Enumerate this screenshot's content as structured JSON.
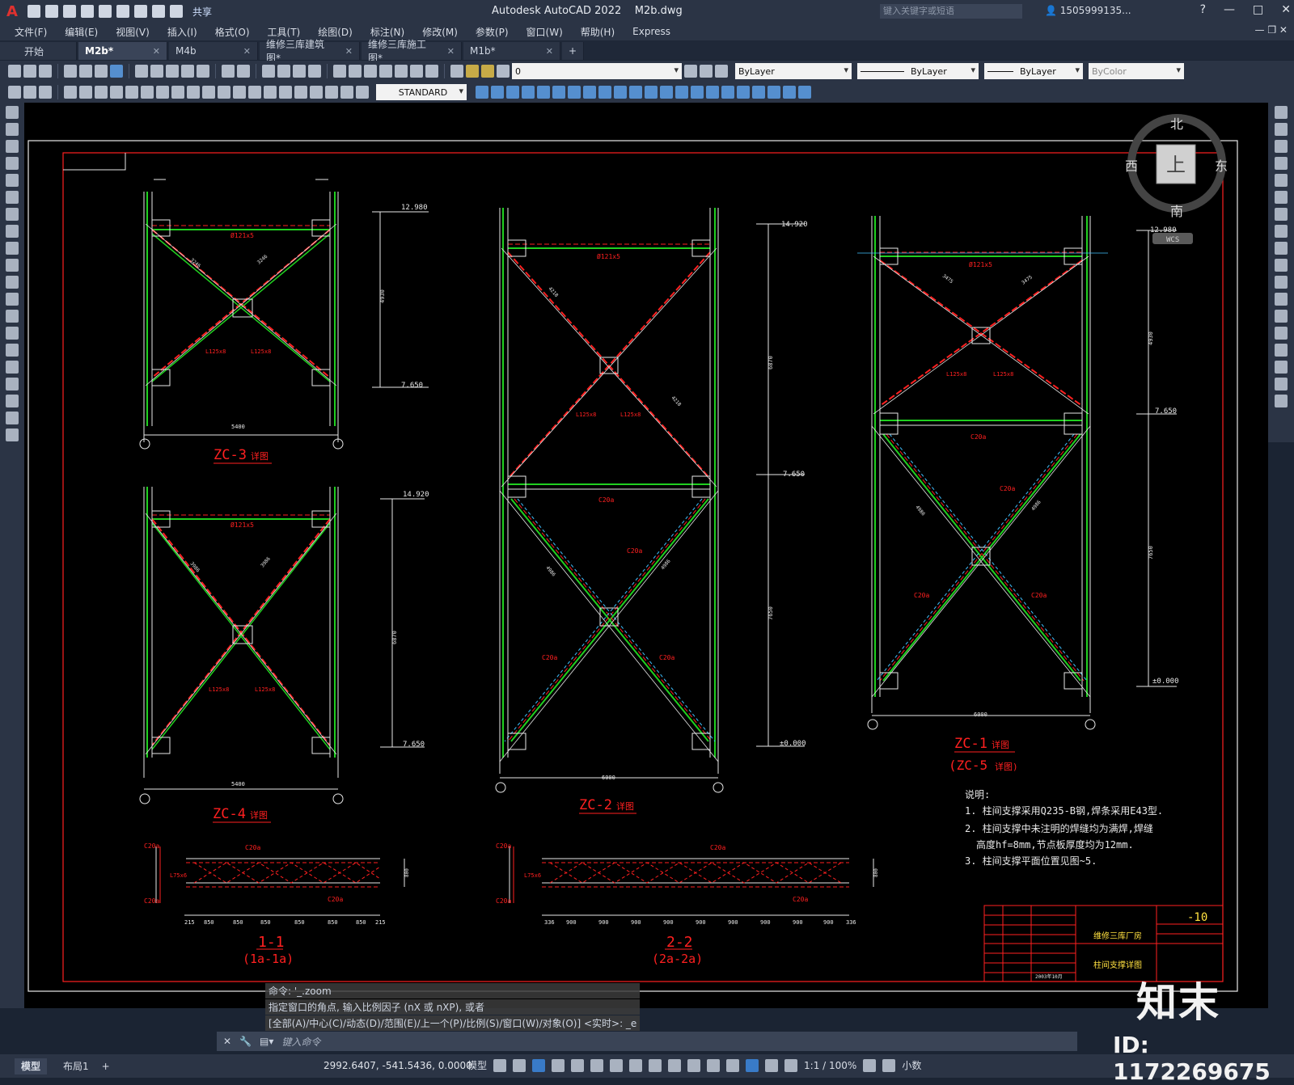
{
  "app": {
    "title": "Autodesk AutoCAD 2022",
    "file": "M2b.dwg",
    "search_placeholder": "键入关键字或短语",
    "user": "1505999135...",
    "share": "共享"
  },
  "menu": [
    "文件(F)",
    "编辑(E)",
    "视图(V)",
    "插入(I)",
    "格式(O)",
    "工具(T)",
    "绘图(D)",
    "标注(N)",
    "修改(M)",
    "参数(P)",
    "窗口(W)",
    "帮助(H)",
    "Express"
  ],
  "tabs": [
    {
      "label": "开始",
      "active": false,
      "closable": false
    },
    {
      "label": "M2b*",
      "active": true,
      "closable": true
    },
    {
      "label": "M4b",
      "active": false,
      "closable": true
    },
    {
      "label": "维修三库建筑图*",
      "active": false,
      "closable": true
    },
    {
      "label": "维修三库施工图*",
      "active": false,
      "closable": true
    },
    {
      "label": "M1b*",
      "active": false,
      "closable": true
    }
  ],
  "toolbar": {
    "layer": "0",
    "color": "ByLayer",
    "linetype": "ByLayer",
    "lineweight": "ByLayer",
    "plotstyle": "ByColor",
    "textstyle": "STANDARD"
  },
  "viewcube": {
    "north": "北",
    "south": "南",
    "east": "东",
    "west": "西",
    "top": "上",
    "wcs": "WCS"
  },
  "drawing": {
    "zc3": {
      "title": "ZC-3",
      "suffix": "详图",
      "width_dim": "5400",
      "top_elev": "12.980",
      "bot_elev": "7.650",
      "height_dim": "4930",
      "rod": "Ø121x5",
      "brace_a": "L125x8",
      "brace_b": "L125x8",
      "diag1": "3246",
      "diag2": "3246"
    },
    "zc4": {
      "title": "ZC-4",
      "suffix": "详图",
      "width_dim": "5400",
      "top_elev": "14.920",
      "bot_elev": "7.650",
      "height_dim": "6870",
      "rod": "Ø121x5",
      "brace_a": "L125x8",
      "brace_b": "L125x8",
      "diag1": "3986",
      "diag2": "3986"
    },
    "zc2": {
      "title": "ZC-2",
      "suffix": "详图",
      "width_dim": "6000",
      "top_elev": "14.920",
      "mid_elev": "7.650",
      "bot_elev": "±0.000",
      "h_upper": "6870",
      "h_lower": "7650",
      "rod": "Ø121x5",
      "brace_a": "L125x8",
      "brace_b": "L125x8",
      "channel": "C20a",
      "diag_upper": "4218",
      "diag_lower": "4986"
    },
    "zc1": {
      "title": "ZC-1",
      "suffix": "详图",
      "subtitle": "(ZC-5",
      "subtitle_end": "详图)",
      "width_dim": "6000",
      "top_elev": "12.980",
      "mid_elev": "7.650",
      "bot_elev": "±0.000",
      "h_upper": "4930",
      "h_lower": "7650",
      "rod": "Ø121x5",
      "brace_a": "L125x8",
      "brace_b": "L125x8",
      "channel": "C20a",
      "diag_upper": "3475",
      "diag_lower": "4986"
    },
    "sec11": {
      "title": "1-1",
      "sub": "(1a-1a)",
      "dims": [
        "215",
        "850",
        "850",
        "850",
        "850",
        "850",
        "850",
        "215"
      ],
      "angle": "L75x6",
      "channel": "C20a",
      "depth": "800"
    },
    "sec22": {
      "title": "2-2",
      "sub": "(2a-2a)",
      "dims": [
        "336",
        "900",
        "900",
        "900",
        "900",
        "900",
        "900",
        "900",
        "900",
        "900",
        "336"
      ],
      "angle": "L75x6",
      "channel": "C20a",
      "depth": "800"
    },
    "notes": {
      "heading": "说明:",
      "lines": [
        "1. 柱间支撑采用Q235-B钢,焊条采用E43型.",
        "2. 柱间支撑中未注明的焊缝均为满焊,焊缝",
        "高度hf=8mm,节点板厚度均为12mm.",
        "3. 柱间支撑平面位置见图~5."
      ]
    },
    "titleblock": {
      "project": "维修三库厂房",
      "drawing": "柱间支撑详图",
      "number": "-10",
      "date": "2003年10月"
    }
  },
  "command": {
    "history": [
      "命令: '_.zoom",
      "指定窗口的角点, 输入比例因子 (nX 或 nXP), 或者",
      "[全部(A)/中心(C)/动态(D)/范围(E)/上一个(P)/比例(S)/窗口(W)/对象(O)] <实时>: _e"
    ],
    "placeholder": "键入命令"
  },
  "layout_tabs": [
    "模型",
    "布局1"
  ],
  "status": {
    "coords": "2992.6407, -541.5436, 0.0000",
    "space": "模型",
    "scale": "1:1 / 100%",
    "units": "小数"
  },
  "watermark": {
    "brand": "知末",
    "id": "ID: 1172269675"
  },
  "colors": {
    "accent_red": "#e0312f",
    "ui_bg": "#2b3445",
    "canvas": "#000000",
    "line_green": "#20d020",
    "line_red": "#ff2020",
    "line_white": "#e8e8e8"
  }
}
